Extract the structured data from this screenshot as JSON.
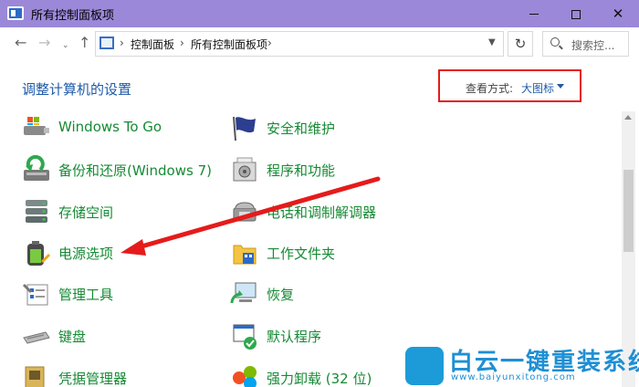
{
  "window": {
    "title": "所有控制面板项"
  },
  "address": {
    "crumbs": [
      "控制面板",
      "所有控制面板项"
    ]
  },
  "search": {
    "placeholder": "搜索控..."
  },
  "heading": "调整计算机的设置",
  "view": {
    "label": "查看方式:",
    "value": "大图标"
  },
  "items_left": [
    {
      "label": "Windows To Go",
      "icon": "usb-drive-icon"
    },
    {
      "label": "备份和还原(Windows 7)",
      "icon": "backup-restore-icon"
    },
    {
      "label": "存储空间",
      "icon": "storage-spaces-icon"
    },
    {
      "label": "电源选项",
      "icon": "power-options-icon"
    },
    {
      "label": "管理工具",
      "icon": "admin-tools-icon"
    },
    {
      "label": "键盘",
      "icon": "keyboard-icon"
    },
    {
      "label": "凭据管理器",
      "icon": "credential-manager-icon"
    }
  ],
  "items_right": [
    {
      "label": "安全和维护",
      "icon": "security-flag-icon"
    },
    {
      "label": "程序和功能",
      "icon": "programs-features-icon"
    },
    {
      "label": "电话和调制解调器",
      "icon": "phone-modem-icon"
    },
    {
      "label": "工作文件夹",
      "icon": "work-folders-icon"
    },
    {
      "label": "恢复",
      "icon": "recovery-icon"
    },
    {
      "label": "默认程序",
      "icon": "default-programs-icon"
    },
    {
      "label": "强力卸载 (32 位)",
      "icon": "uninstaller-icon"
    }
  ],
  "watermark": {
    "title": "白云一键重装系统",
    "url": "www.baiyunxitong.com"
  },
  "colors": {
    "titlebar": "#9b88d8",
    "link": "#1e5aa8",
    "item": "#168a34",
    "annotation": "#e51b1b"
  }
}
